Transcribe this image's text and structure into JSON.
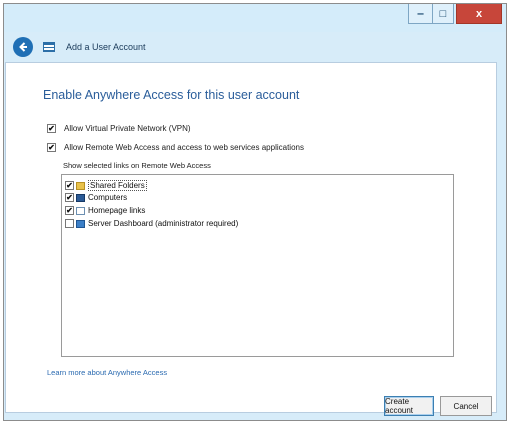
{
  "window": {
    "title": "Add a User Account",
    "buttons": {
      "minimize": "‒",
      "maximize": "□",
      "close": "x"
    }
  },
  "page": {
    "heading": "Enable Anywhere Access for this user account",
    "vpn_label": "Allow Virtual Private Network (VPN)",
    "vpn_checked": true,
    "rwa_label": "Allow Remote Web Access and access to web services applications",
    "rwa_checked": true,
    "links_label": "Show selected links on Remote Web Access",
    "links": [
      {
        "label": "Shared Folders",
        "checked": true,
        "icon": "folder-icon"
      },
      {
        "label": "Computers",
        "checked": true,
        "icon": "computer-icon"
      },
      {
        "label": "Homepage links",
        "checked": true,
        "icon": "homepage-icon"
      },
      {
        "label": "Server Dashboard (administrator required)",
        "checked": false,
        "icon": "dashboard-icon"
      }
    ],
    "learn_more": "Learn more about Anywhere Access"
  },
  "footer": {
    "create_label": "Create account",
    "cancel_label": "Cancel"
  },
  "colors": {
    "accent": "#1f6fb5",
    "heading": "#2a5d9a",
    "close_button": "#c7463a",
    "frame": "#d7ecf9"
  }
}
